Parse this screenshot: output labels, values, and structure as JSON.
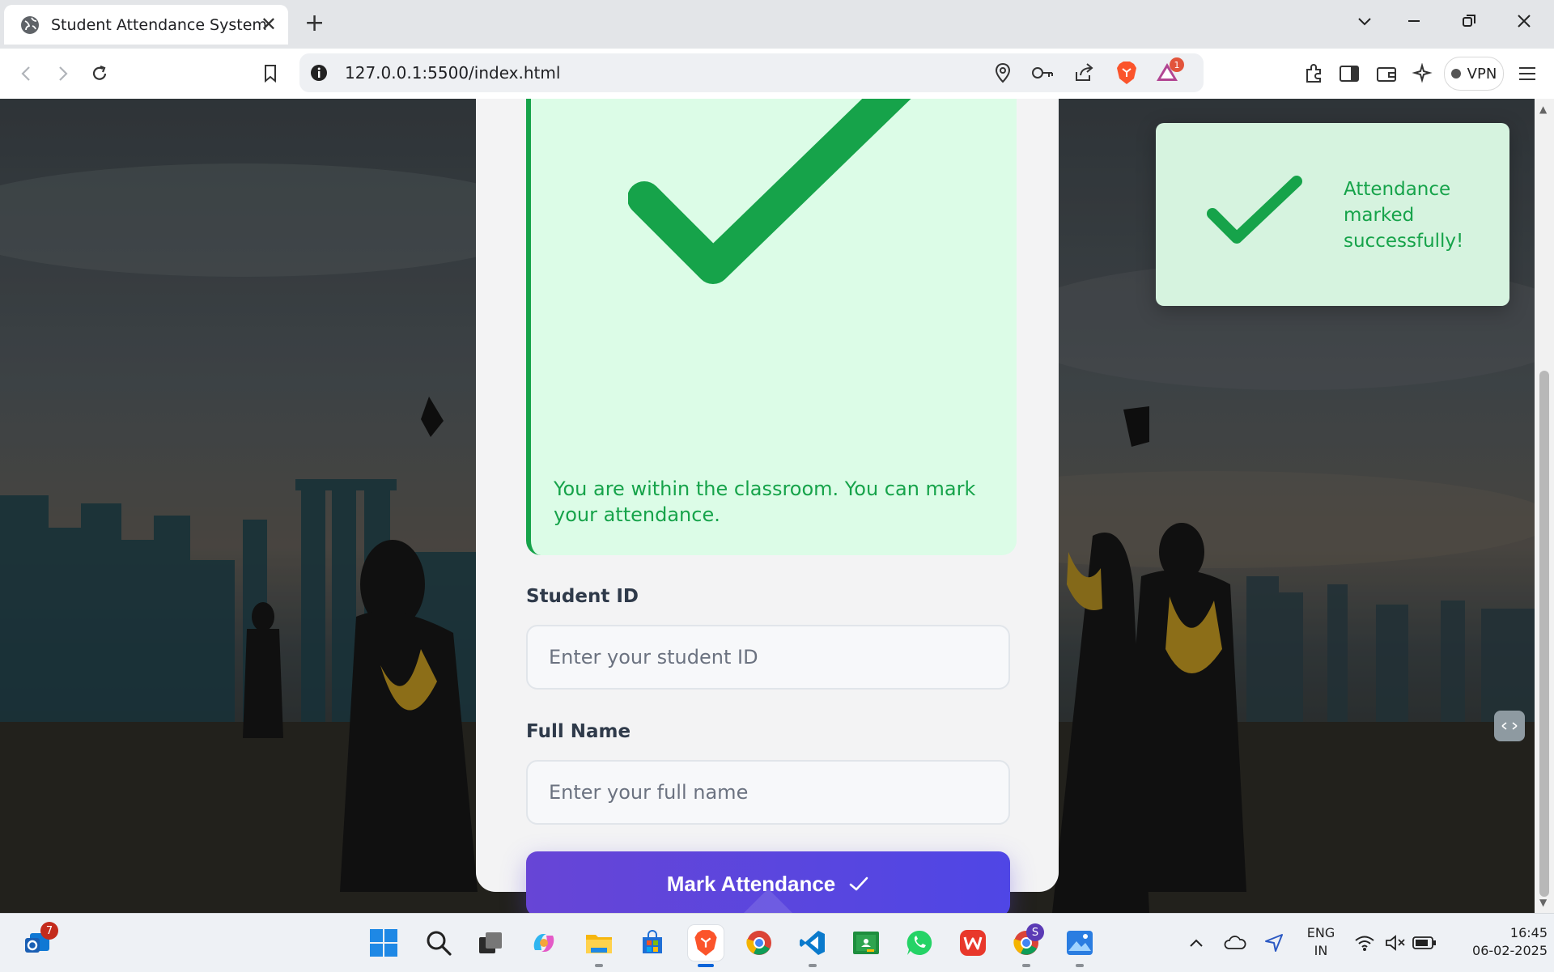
{
  "browser": {
    "tab_title": "Student Attendance System",
    "url": "127.0.0.1:5500/index.html",
    "vpn_label": "VPN",
    "brave_rewards_count": "1"
  },
  "page": {
    "location_alert": "You are within the classroom. You can mark your attendance.",
    "student_id_label": "Student ID",
    "student_id_placeholder": "Enter your student ID",
    "full_name_label": "Full Name",
    "full_name_placeholder": "Enter your full name",
    "submit_label": "Mark Attendance",
    "toast_message": "Attendance marked successfully!"
  },
  "colors": {
    "success_green": "#16a34a",
    "alert_bg": "#dcfce7",
    "button_start": "#6745d6",
    "button_end": "#4f46e5"
  },
  "taskbar": {
    "outlook_badge": "7",
    "chrome_profile_initial": "S",
    "language_line1": "ENG",
    "language_line2": "IN",
    "time": "16:45",
    "date": "06-02-2025"
  }
}
